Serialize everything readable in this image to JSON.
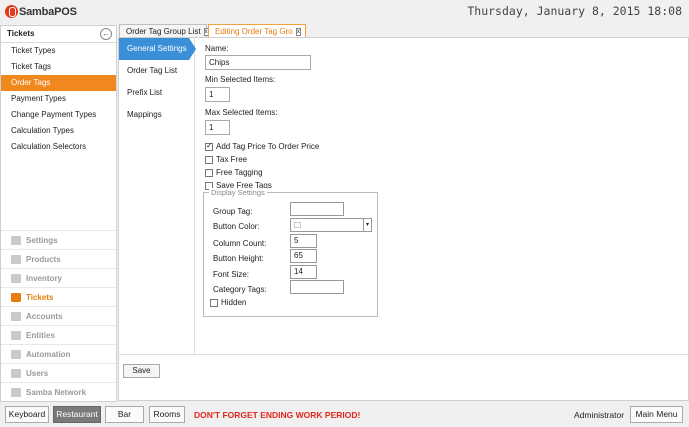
{
  "header": {
    "logo": "SambaPOS",
    "datetime": "Thursday, January 8, 2015 18:08"
  },
  "sidebar": {
    "title": "Tickets",
    "items": [
      {
        "label": "Ticket Types",
        "active": false
      },
      {
        "label": "Ticket Tags",
        "active": false
      },
      {
        "label": "Order Tags",
        "active": true
      },
      {
        "label": "Payment Types",
        "active": false
      },
      {
        "label": "Change Payment Types",
        "active": false
      },
      {
        "label": "Calculation Types",
        "active": false
      },
      {
        "label": "Calculation Selectors",
        "active": false
      }
    ],
    "modules": [
      {
        "label": "Settings",
        "icon": "gear-icon"
      },
      {
        "label": "Products",
        "icon": "cup-icon"
      },
      {
        "label": "Inventory",
        "icon": "truck-icon"
      },
      {
        "label": "Tickets",
        "icon": "books-icon",
        "active": true
      },
      {
        "label": "Accounts",
        "icon": "calculator-icon"
      },
      {
        "label": "Entities",
        "icon": "grid-icon"
      },
      {
        "label": "Automation",
        "icon": "pencil-icon"
      },
      {
        "label": "Users",
        "icon": "user-icon"
      },
      {
        "label": "Samba Network",
        "icon": "globe-icon"
      }
    ]
  },
  "tabs": [
    {
      "label": "Order Tag Group List",
      "close": "x"
    },
    {
      "label": "Editing Order Tag Gro",
      "close": "x"
    }
  ],
  "subnav": [
    "General Settings",
    "Order Tag List",
    "Prefix List",
    "Mappings"
  ],
  "form": {
    "name_label": "Name:",
    "name_value": "Chips",
    "min_label": "Min Selected Items:",
    "min_value": "1",
    "max_label": "Max Selected Items:",
    "max_value": "1",
    "checkboxes": [
      {
        "label": "Add Tag Price To Order Price",
        "checked": true
      },
      {
        "label": "Tax Free",
        "checked": false
      },
      {
        "label": "Free Tagging",
        "checked": false
      },
      {
        "label": "Save Free Tags",
        "checked": false
      }
    ],
    "display_settings": {
      "title": "Display Settings",
      "group_tag_label": "Group Tag:",
      "group_tag_value": "",
      "button_color_label": "Button Color:",
      "column_count_label": "Column Count:",
      "column_count_value": "5",
      "button_height_label": "Button Height:",
      "button_height_value": "65",
      "font_size_label": "Font Size:",
      "font_size_value": "14",
      "category_tags_label": "Category Tags:",
      "category_tags_value": "",
      "hidden_label": "Hidden"
    },
    "save_label": "Save"
  },
  "bottom": {
    "keyboard": "Keyboard",
    "restaurant": "Restaurant",
    "bar": "Bar",
    "rooms": "Rooms",
    "warning": "DON'T FORGET ENDING WORK PERIOD!",
    "user": "Administrator",
    "main_menu": "Main Menu"
  },
  "colors": {
    "accent": "#f0881e",
    "subnav_active": "#3a8fd8",
    "warning": "#e2261b"
  }
}
